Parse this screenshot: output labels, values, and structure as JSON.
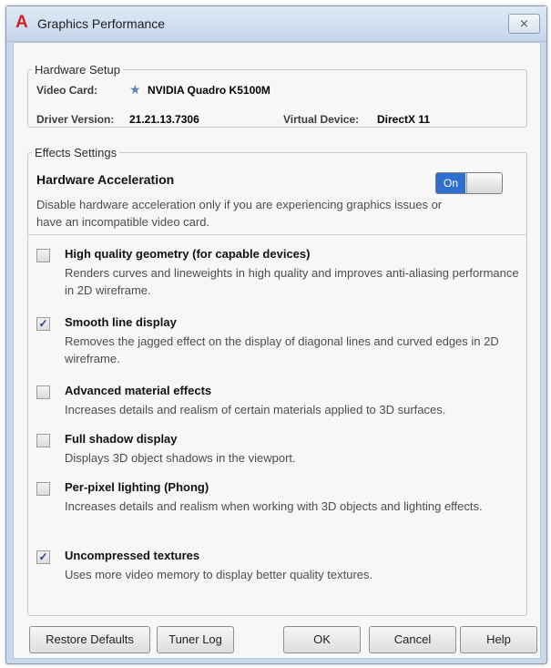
{
  "window": {
    "title": "Graphics Performance",
    "app_icon_glyph": "A",
    "close_glyph": "⨯"
  },
  "hardware_setup": {
    "legend": "Hardware Setup",
    "video_card_label": "Video Card:",
    "video_card_value": "NVIDIA Quadro K5100M",
    "driver_version_label": "Driver Version:",
    "driver_version_value": "21.21.13.7306",
    "virtual_device_label": "Virtual Device:",
    "virtual_device_value": "DirectX 11"
  },
  "effects_settings": {
    "legend": "Effects Settings",
    "hardware_acceleration": {
      "title": "Hardware Acceleration",
      "description": "Disable hardware acceleration only if you are experiencing graphics issues or have an incompatible video card.",
      "toggle_label": "On",
      "enabled": true
    },
    "options": [
      {
        "title": "High quality geometry (for capable devices)",
        "description": "Renders curves and lineweights in high quality and improves anti-aliasing performance in 2D wireframe.",
        "checked": false
      },
      {
        "title": "Smooth line display",
        "description": "Removes the jagged effect on the display of diagonal lines and curved edges in 2D wireframe.",
        "checked": true
      },
      {
        "title": "Advanced material effects",
        "description": "Increases details and realism of certain materials applied to 3D surfaces.",
        "checked": false
      },
      {
        "title": "Full shadow display",
        "description": "Displays 3D object shadows in the viewport.",
        "checked": false
      },
      {
        "title": "Per-pixel lighting (Phong)",
        "description": "Increases details and realism when working with 3D objects and lighting effects.",
        "checked": false
      },
      {
        "title": "Uncompressed textures",
        "description": "Uses more video memory to display better quality textures.",
        "checked": true
      }
    ]
  },
  "buttons": {
    "restore_defaults": "Restore Defaults",
    "tuner_log": "Tuner Log",
    "ok": "OK",
    "cancel": "Cancel",
    "help": "Help"
  },
  "colors": {
    "accent_toggle": "#2f6fcf",
    "app_icon": "#d21f1f",
    "title_bar": "#c9d9ec"
  }
}
